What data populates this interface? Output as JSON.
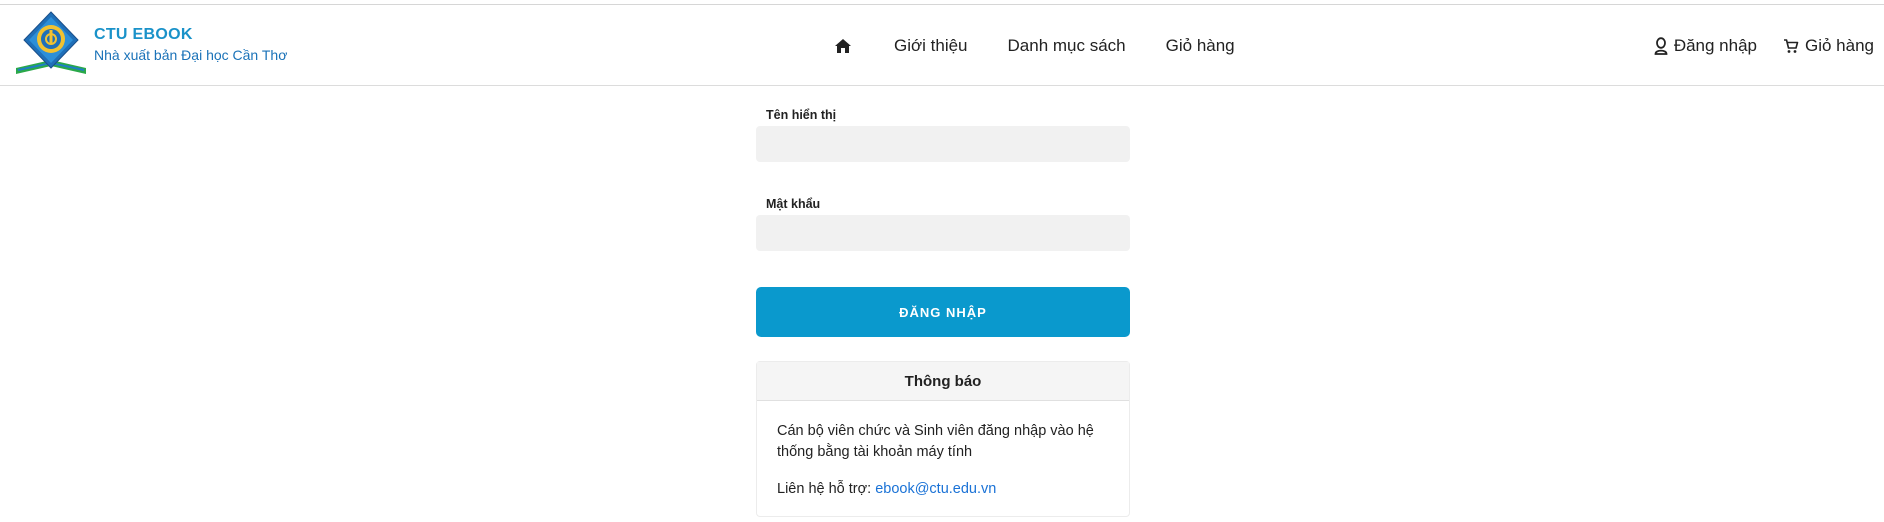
{
  "brand": {
    "title": "CTU EBOOK",
    "subtitle": "Nhà xuất bản Đại học Cần Thơ"
  },
  "nav": {
    "home_icon": "home-icon",
    "items": [
      {
        "label": "Giới thiệu"
      },
      {
        "label": "Danh mục sách"
      },
      {
        "label": "Giỏ hàng"
      }
    ]
  },
  "user_nav": {
    "login_label": "Đăng nhập",
    "login_icon": "user-icon",
    "cart_label": "Giỏ hàng",
    "cart_icon": "cart-icon"
  },
  "form": {
    "username_label": "Tên hiển thị",
    "username_value": "",
    "password_label": "Mật khẩu",
    "password_value": "",
    "submit_label": "ĐĂNG NHẬP"
  },
  "notice": {
    "title": "Thông báo",
    "message": "Cán bộ viên chức và Sinh viên đăng nhập vào hệ thống bằng tài khoản máy tính",
    "support_prefix": "Liên hệ hỗ trợ:",
    "support_email": "ebook@ctu.edu.vn"
  },
  "colors": {
    "accent": "#0a99cd",
    "brand_blue": "#1a92c9",
    "link": "#1a72d6"
  }
}
